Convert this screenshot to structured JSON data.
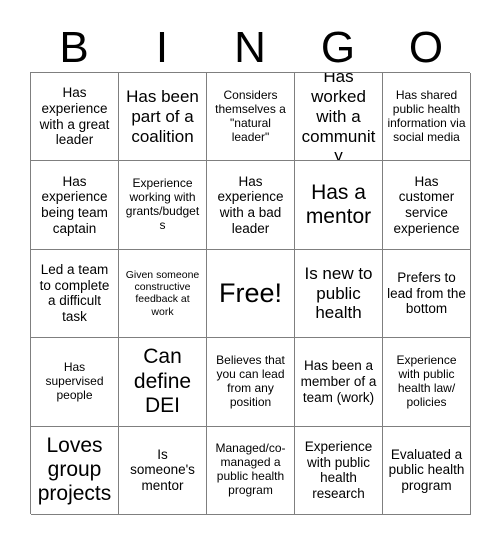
{
  "card": {
    "header_letters": [
      "B",
      "I",
      "N",
      "G",
      "O"
    ],
    "columns": 5,
    "rows": 5,
    "colors": {
      "background": "#ffffff",
      "text": "#000000",
      "grid_line": "#7f7f7f"
    },
    "cells": [
      {
        "text": "Has experience with a great leader",
        "size": "md"
      },
      {
        "text": "Has been part of a coalition",
        "size": "lg"
      },
      {
        "text": "Considers themselves a \"natural leader\"",
        "size": "sm"
      },
      {
        "text": "Has worked with a community",
        "size": "lg"
      },
      {
        "text": "Has shared public health information via social media",
        "size": "sm"
      },
      {
        "text": "Has experience being team captain",
        "size": "md"
      },
      {
        "text": "Experience working with grants/budgets",
        "size": "sm"
      },
      {
        "text": "Has experience with a bad leader",
        "size": "md"
      },
      {
        "text": "Has a mentor",
        "size": "xl"
      },
      {
        "text": "Has customer service experience",
        "size": "md"
      },
      {
        "text": "Led a team to complete a difficult task",
        "size": "md"
      },
      {
        "text": "Given someone constructive feedback at work",
        "size": "xs"
      },
      {
        "text": "Free!",
        "size": "xxl"
      },
      {
        "text": "Is new to public health",
        "size": "lg"
      },
      {
        "text": "Prefers to lead from the bottom",
        "size": "md"
      },
      {
        "text": "Has supervised people",
        "size": "sm"
      },
      {
        "text": "Can define DEI",
        "size": "xl"
      },
      {
        "text": "Believes that you can lead from any position",
        "size": "sm"
      },
      {
        "text": "Has been a member of a team (work)",
        "size": "md"
      },
      {
        "text": "Experience with public health law/ policies",
        "size": "sm"
      },
      {
        "text": "Loves group projects",
        "size": "xl"
      },
      {
        "text": "Is someone's mentor",
        "size": "md"
      },
      {
        "text": "Managed/co-managed a public health program",
        "size": "sm"
      },
      {
        "text": "Experience with public health research",
        "size": "md"
      },
      {
        "text": "Evaluated a public health program",
        "size": "md"
      }
    ]
  }
}
